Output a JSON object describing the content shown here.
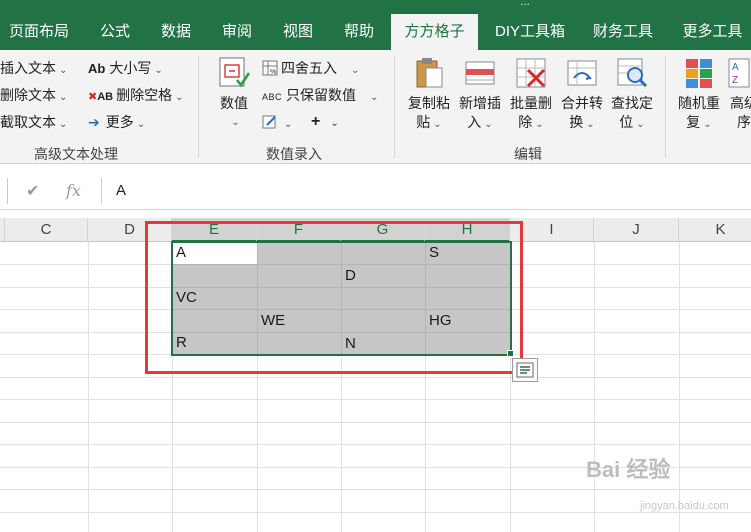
{
  "title_fragment": "...",
  "tabs": [
    {
      "label": "页面布局",
      "active": false
    },
    {
      "label": "公式",
      "active": false
    },
    {
      "label": "数据",
      "active": false
    },
    {
      "label": "审阅",
      "active": false
    },
    {
      "label": "视图",
      "active": false
    },
    {
      "label": "帮助",
      "active": false
    },
    {
      "label": "方方格子",
      "active": true
    },
    {
      "label": "DIY工具箱",
      "active": false
    },
    {
      "label": "财务工具",
      "active": false
    },
    {
      "label": "更多工具",
      "active": false
    }
  ],
  "ribbon": {
    "text_group": {
      "items": [
        "插入文本",
        "删除文本",
        "截取文本"
      ],
      "items2": [
        "大小写",
        "删除空格",
        "更多"
      ],
      "label": "高级文本处理"
    },
    "number_group": {
      "big_label": "数值",
      "round": "四舍五入",
      "keep": "只保留数值",
      "label": "数值录入"
    },
    "edit_group": {
      "buttons": [
        {
          "line1": "复制粘",
          "line2": "贴"
        },
        {
          "line1": "新增插",
          "line2": "入"
        },
        {
          "line1": "批量删",
          "line2": "除"
        },
        {
          "line1": "合并转",
          "line2": "换"
        },
        {
          "line1": "查找定",
          "line2": "位"
        }
      ],
      "label": "编辑"
    },
    "more_group": {
      "buttons": [
        {
          "line1": "随机重",
          "line2": "复"
        },
        {
          "line1": "高级",
          "line2": "序"
        }
      ]
    }
  },
  "formula_bar": {
    "cancel_icon": "✔",
    "fx": "fx",
    "value": "A"
  },
  "columns": [
    "C",
    "D",
    "E",
    "F",
    "G",
    "H",
    "I",
    "J",
    "K"
  ],
  "selected_columns": [
    "E",
    "F",
    "G",
    "H"
  ],
  "cells": {
    "E1": "A",
    "H1": "S",
    "G2": "D",
    "E3": "VC",
    "F4": "WE",
    "H4": "HG",
    "E5": "R",
    "G5": "N"
  },
  "colors": {
    "brand": "#217346",
    "highlight_box": "#e23a3a",
    "selection_fill": "#c6c6c6"
  },
  "watermark": {
    "text": "Bai 经验",
    "sub": "jingyan.baidu.com"
  }
}
